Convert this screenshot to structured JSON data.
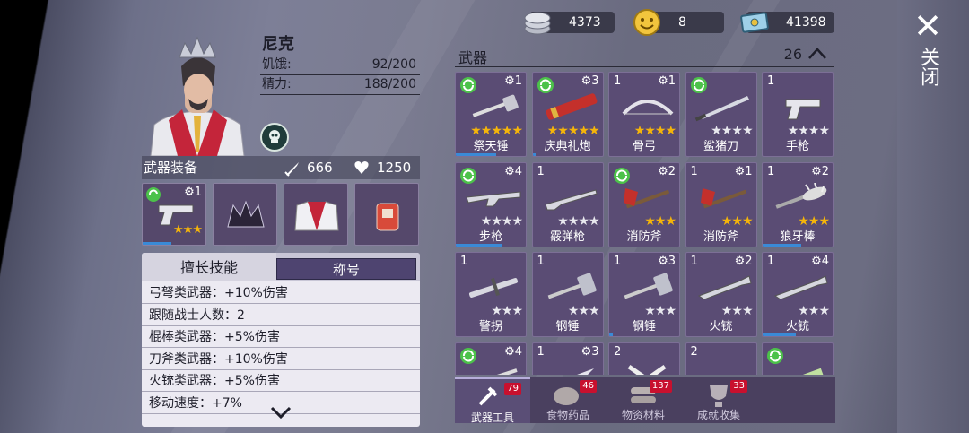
{
  "header": {
    "close_label": "关闭",
    "currencies": [
      {
        "icon": "silver-coins-icon",
        "value": "4373"
      },
      {
        "icon": "smiley-coin-icon",
        "value": "8"
      },
      {
        "icon": "banknote-icon",
        "value": "41398"
      }
    ]
  },
  "character": {
    "name": "尼克",
    "stats": [
      {
        "label": "饥饿:",
        "value": "92/200"
      },
      {
        "label": "精力:",
        "value": "188/200"
      }
    ]
  },
  "equipment": {
    "title": "武器装备",
    "attack": "666",
    "health": "1250",
    "slots": [
      {
        "icon": "pistol-icon",
        "level": "1",
        "stars": 3,
        "refresh": true
      },
      {
        "icon": "crown-helmet-icon"
      },
      {
        "icon": "armor-vest-icon"
      },
      {
        "icon": "backpack-icon"
      }
    ]
  },
  "skills": {
    "tab_skill": "擅长技能",
    "tab_title": "称号",
    "rows": [
      "弓弩类武器：+10%伤害",
      "跟随战士人数：2",
      "棍棒类武器：+5%伤害",
      "刀斧类武器：+10%伤害",
      "火铳类武器：+5%伤害",
      "移动速度：+7%"
    ]
  },
  "inventory": {
    "title": "武器",
    "count": "26",
    "items": [
      {
        "name": "祭天锤",
        "left": "",
        "level": "1",
        "stars": 5,
        "max": 5,
        "refresh": true,
        "bar": 0.58,
        "icon": "hammer-icon"
      },
      {
        "name": "庆典礼炮",
        "left": "",
        "level": "3",
        "stars": 5,
        "max": 5,
        "refresh": true,
        "bar": 0.05,
        "icon": "cannon-icon"
      },
      {
        "name": "骨弓",
        "left": "1",
        "level": "1",
        "stars": 4,
        "max": 4,
        "refresh": false,
        "bar": 0,
        "icon": "bow-icon"
      },
      {
        "name": "鲨猪刀",
        "left": "",
        "level": "",
        "stars": 0,
        "max": 4,
        "refresh": true,
        "bar": 0,
        "icon": "blade-icon"
      },
      {
        "name": "手枪",
        "left": "1",
        "level": "",
        "stars": 0,
        "max": 4,
        "refresh": false,
        "bar": 0,
        "icon": "pistol-icon"
      },
      {
        "name": "步枪",
        "left": "",
        "level": "4",
        "stars": 0,
        "max": 4,
        "refresh": true,
        "bar": 0.66,
        "icon": "rifle-icon"
      },
      {
        "name": "霰弹枪",
        "left": "1",
        "level": "",
        "stars": 0,
        "max": 4,
        "refresh": false,
        "bar": 0,
        "icon": "shotgun-icon"
      },
      {
        "name": "消防斧",
        "left": "",
        "level": "2",
        "stars": 3,
        "max": 3,
        "refresh": true,
        "bar": 0,
        "icon": "axe-icon"
      },
      {
        "name": "消防斧",
        "left": "1",
        "level": "1",
        "stars": 3,
        "max": 3,
        "refresh": false,
        "bar": 0,
        "icon": "axe-icon"
      },
      {
        "name": "狼牙棒",
        "left": "1",
        "level": "2",
        "stars": 3,
        "max": 3,
        "refresh": false,
        "bar": 0.55,
        "icon": "mace-icon"
      },
      {
        "name": "警拐",
        "left": "1",
        "level": "",
        "stars": 0,
        "max": 3,
        "refresh": false,
        "bar": 0,
        "icon": "baton-icon"
      },
      {
        "name": "钢锤",
        "left": "1",
        "level": "",
        "stars": 0,
        "max": 3,
        "refresh": false,
        "bar": 0,
        "icon": "sledgehammer-icon"
      },
      {
        "name": "钢锤",
        "left": "1",
        "level": "3",
        "stars": 0,
        "max": 3,
        "refresh": false,
        "bar": 0.05,
        "icon": "sledgehammer-icon"
      },
      {
        "name": "火铳",
        "left": "1",
        "level": "2",
        "stars": 0,
        "max": 3,
        "refresh": false,
        "bar": 0,
        "icon": "blunderbuss-icon"
      },
      {
        "name": "火铳",
        "left": "1",
        "level": "4",
        "stars": 0,
        "max": 3,
        "refresh": false,
        "bar": 0.48,
        "icon": "blunderbuss-icon"
      },
      {
        "name": "",
        "left": "",
        "level": "4",
        "stars": 0,
        "max": 0,
        "refresh": true,
        "bar": 0,
        "icon": "crossbow-icon"
      },
      {
        "name": "",
        "left": "1",
        "level": "3",
        "stars": 0,
        "max": 0,
        "refresh": false,
        "bar": 0,
        "icon": "knife-icon"
      },
      {
        "name": "",
        "left": "2",
        "level": "",
        "stars": 0,
        "max": 0,
        "refresh": false,
        "bar": 0,
        "icon": "shield-icon"
      },
      {
        "name": "",
        "left": "2",
        "level": "",
        "stars": 0,
        "max": 0,
        "refresh": false,
        "bar": 0,
        "icon": "drill-icon"
      },
      {
        "name": "",
        "left": "",
        "level": "",
        "stars": 0,
        "max": 0,
        "refresh": true,
        "bar": 0,
        "icon": "launcher-icon"
      }
    ]
  },
  "bottom_tabs": [
    {
      "label": "武器工具",
      "badge": "79",
      "active": true,
      "icon": "tools-icon"
    },
    {
      "label": "食物药品",
      "badge": "46",
      "active": false,
      "icon": "food-icon"
    },
    {
      "label": "物资材料",
      "badge": "137",
      "active": false,
      "icon": "logs-icon"
    },
    {
      "label": "成就收集",
      "badge": "33",
      "active": false,
      "icon": "trophy-icon"
    }
  ],
  "colors": {
    "accent": "#5a4c74",
    "star": "#f5b50a",
    "badge": "#c8102e",
    "bar": "#3a8ad6"
  }
}
